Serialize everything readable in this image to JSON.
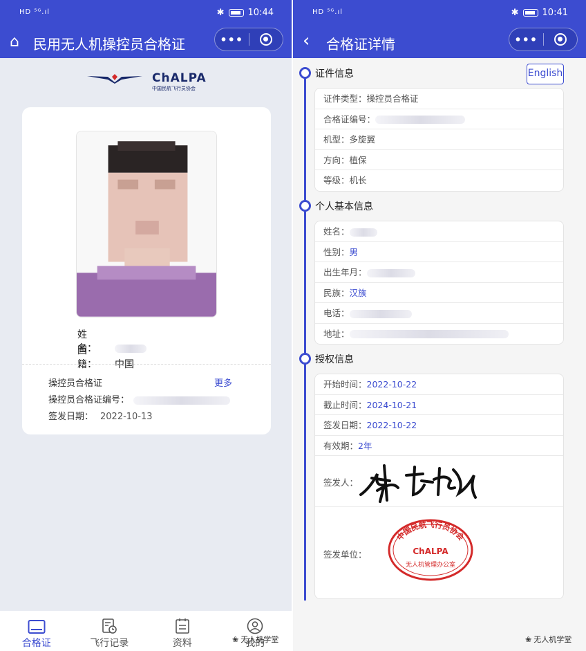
{
  "left": {
    "status": {
      "time": "10:44",
      "indicators": "HD ⁵ᴳ.ıl"
    },
    "nav": {
      "title": "民用无人机操控员合格证"
    },
    "logo": {
      "name": "ChALPA",
      "sub": "中国民航飞行员协会"
    },
    "card": {
      "name_key": "姓　名：",
      "name_value": "",
      "nationality_key": "国　籍：",
      "nationality_value": "中国",
      "cert_title": "操控员合格证",
      "more": "更多",
      "cert_no_key": "操控员合格证编号：",
      "issue_key": "签发日期：",
      "issue_value": "2022-10-13"
    },
    "tabs": [
      {
        "label": "合格证",
        "icon": "id-card-icon"
      },
      {
        "label": "飞行记录",
        "icon": "flight-log-icon"
      },
      {
        "label": "资料",
        "icon": "document-icon"
      },
      {
        "label": "我的",
        "icon": "profile-icon"
      }
    ],
    "watermark": "无人机学堂"
  },
  "right": {
    "status": {
      "time": "10:41",
      "indicators": "HD ⁵ᴳ.ıl"
    },
    "nav": {
      "title": "合格证详情"
    },
    "lang_button": "English",
    "sections": [
      {
        "title": "证件信息",
        "rows": [
          {
            "label": "证件类型：",
            "value": "操控员合格证",
            "style": "g"
          },
          {
            "label": "合格证编号：",
            "value": "",
            "style": "g"
          },
          {
            "label": "机型：",
            "value": "多旋翼",
            "style": "g"
          },
          {
            "label": "方向：",
            "value": "植保",
            "style": "g"
          },
          {
            "label": "等级：",
            "value": "机长",
            "style": "g"
          }
        ]
      },
      {
        "title": "个人基本信息",
        "rows": [
          {
            "label": "姓名：",
            "value": "",
            "style": "v"
          },
          {
            "label": "性别：",
            "value": "男",
            "style": "v"
          },
          {
            "label": "出生年月：",
            "value": "",
            "style": "v"
          },
          {
            "label": "民族：",
            "value": "汉族",
            "style": "v"
          },
          {
            "label": "电话：",
            "value": "",
            "style": "v"
          },
          {
            "label": "地址：",
            "value": "",
            "style": "v"
          }
        ]
      },
      {
        "title": "授权信息",
        "rows": [
          {
            "label": "开始时间：",
            "value": "2022-10-22",
            "style": "v"
          },
          {
            "label": "截止时间：",
            "value": "2024-10-21",
            "style": "v"
          },
          {
            "label": "签发日期：",
            "value": "2022-10-22",
            "style": "v"
          },
          {
            "label": "有效期：",
            "value": "2年",
            "style": "v"
          }
        ]
      }
    ],
    "signer_label": "签发人：",
    "issuer_label": "签发单位：",
    "stamp": {
      "top": "中国民航飞行员协会",
      "middle": "ChALPA",
      "bottom": "无人机管理办公室"
    },
    "watermark": "无人机学堂"
  },
  "colors": {
    "brand": "#3c4cd0",
    "stamp": "#d42a2a"
  }
}
